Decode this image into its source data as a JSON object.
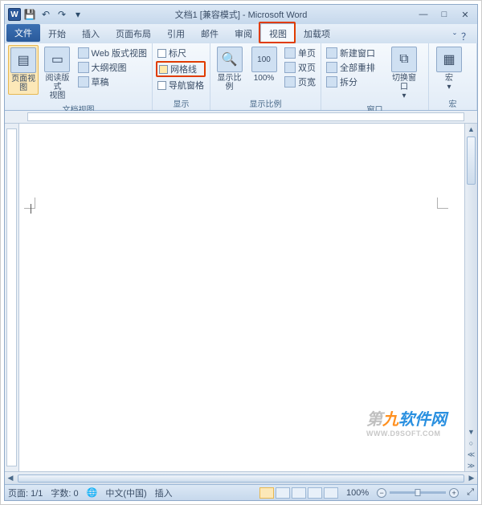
{
  "title": "文档1 [兼容模式] - Microsoft Word",
  "word_icon_letter": "W",
  "qat": {
    "save": "💾",
    "undo": "↶",
    "redo": "↷",
    "more": "▾"
  },
  "win": {
    "min": "—",
    "max": "□",
    "close": "✕"
  },
  "tabs": {
    "file": "文件",
    "items": [
      "开始",
      "插入",
      "页面布局",
      "引用",
      "邮件",
      "审阅",
      "视图",
      "加载项"
    ],
    "active_index": 6,
    "highlight_index": 6
  },
  "help": {
    "caret": "ˇ",
    "q": "？"
  },
  "ribbon": {
    "views": {
      "page_layout": "页面视图",
      "reading": {
        "l1": "阅读版式",
        "l2": "视图"
      },
      "web": "Web 版式视图",
      "outline": "大纲视图",
      "draft": "草稿",
      "group_label": "文档视图"
    },
    "show": {
      "ruler": "标尺",
      "gridlines": "网格线",
      "nav": "导航窗格",
      "group_label": "显示"
    },
    "zoom": {
      "zoom": "显示比例",
      "pct": "100%",
      "one_page": "单页",
      "two_page": "双页",
      "page_width": "页宽",
      "group_label": "显示比例"
    },
    "window": {
      "new_win": "新建窗口",
      "arrange": "全部重排",
      "split": "拆分",
      "switch": {
        "l1": "切换窗口",
        "l2": "▾"
      },
      "group_label": "窗口"
    },
    "macros": {
      "label": "宏",
      "caret": "▾"
    }
  },
  "status": {
    "page": "页面: 1/1",
    "words": "字数: 0",
    "lang_icon": "🌐",
    "lang": "中文(中国)",
    "mode": "插入",
    "zoom_pct": "100%",
    "minus": "−",
    "plus": "+",
    "expand": "⤢"
  },
  "watermark": {
    "t1": "第",
    "t2": "九",
    "t3": "软件网",
    "url": "WWW.D9SOFT.COM"
  }
}
